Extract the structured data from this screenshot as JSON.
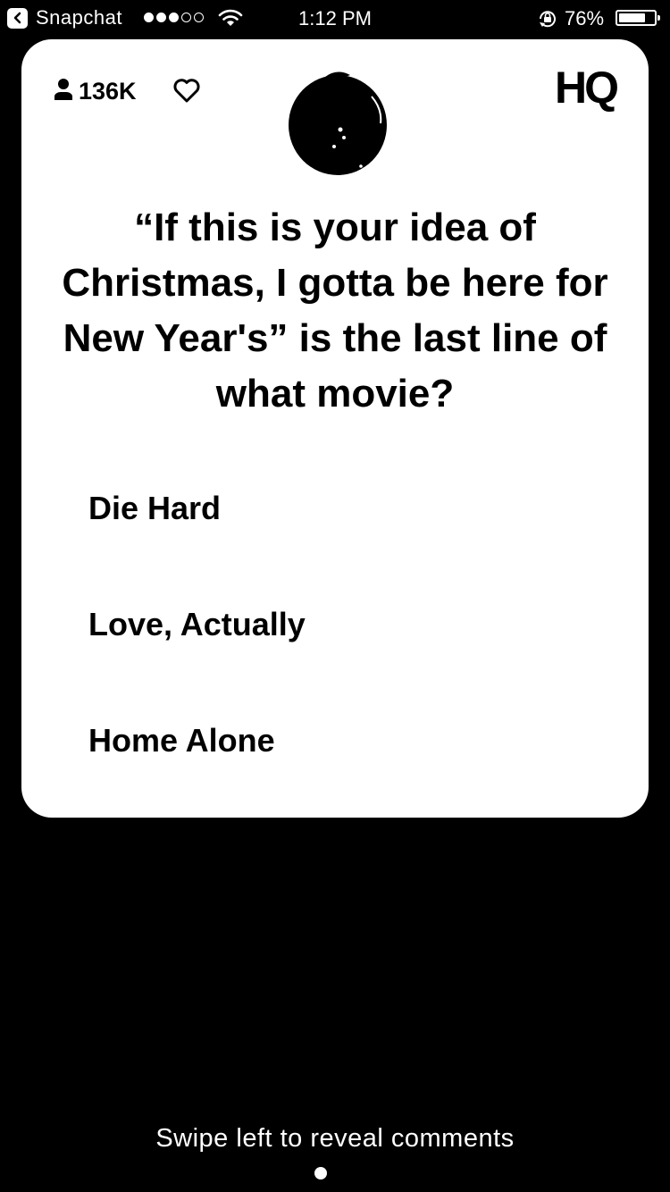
{
  "status_bar": {
    "back_app_label": "Snapchat",
    "signal_filled": 3,
    "signal_total": 5,
    "time": "1:12 PM",
    "battery_percent_text": "76%",
    "battery_level": 0.76
  },
  "card": {
    "viewer_count": "136K",
    "logo_text": "HQ",
    "question": "“If this is your idea of Christmas, I gotta be here for New Year's” is the last line of what movie?",
    "answers": [
      "Die Hard",
      "Love, Actually",
      "Home Alone"
    ]
  },
  "footer": {
    "swipe_hint": "Swipe left to reveal comments"
  }
}
